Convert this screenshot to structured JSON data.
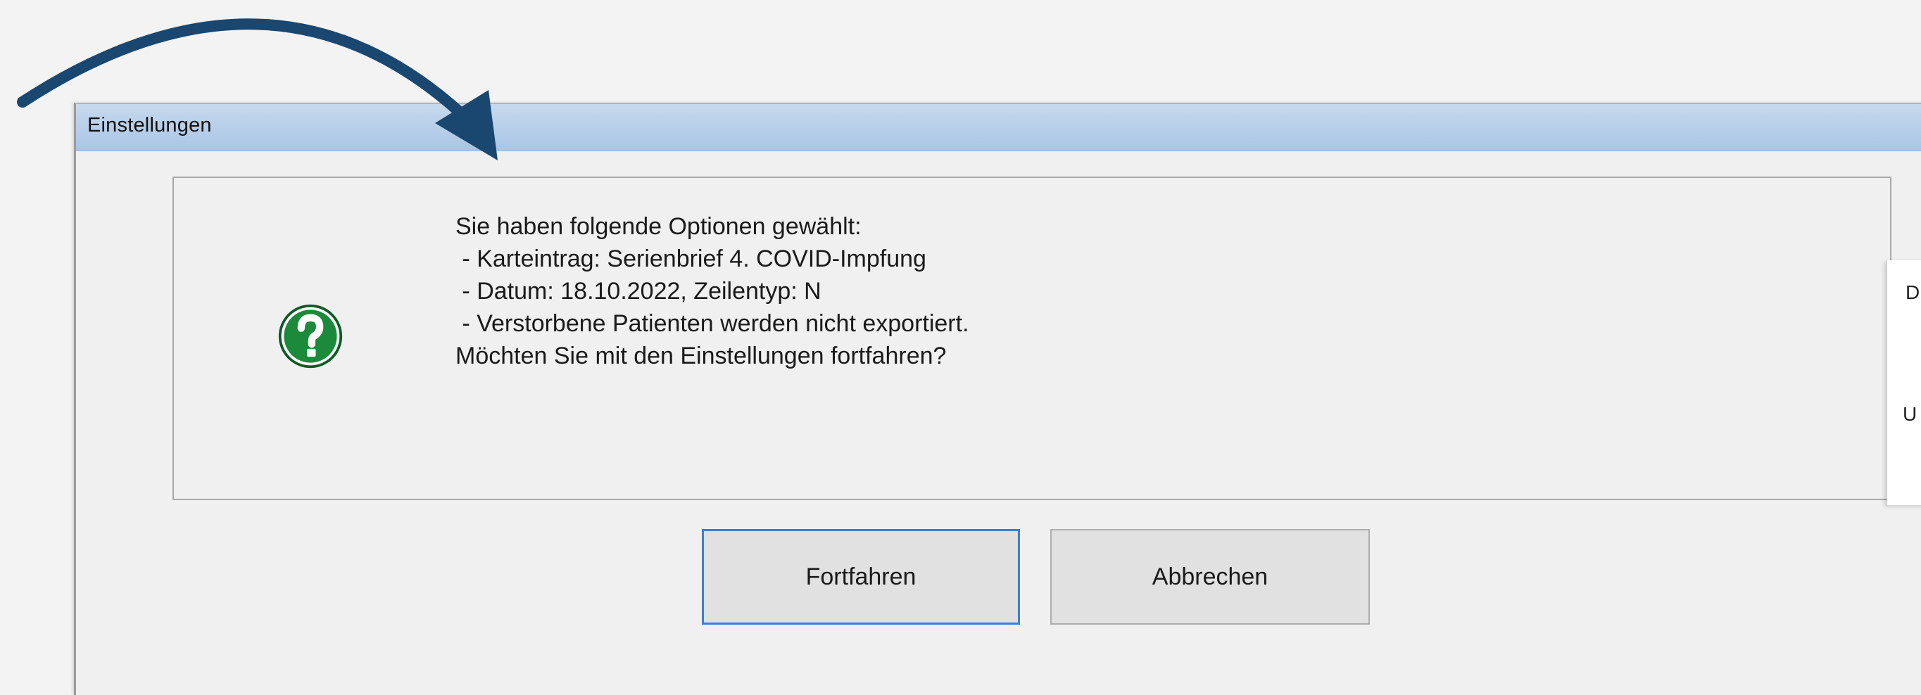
{
  "annotation": {
    "arrow_color": "#1a4770"
  },
  "dialog": {
    "title": "Einstellungen",
    "icon": "question-icon",
    "icon_color": "#1b8a3a",
    "message_lines": [
      "Sie haben folgende Optionen gewählt:",
      " - Karteintrag: Serienbrief 4. COVID-Impfung",
      " - Datum: 18.10.2022, Zeilentyp: N",
      " - Verstorbene Patienten werden nicht exportiert.",
      "Möchten Sie mit den Einstellungen fortfahren?"
    ],
    "buttons": {
      "continue_label": "Fortfahren",
      "cancel_label": "Abbrechen"
    }
  },
  "background_window": {
    "label_top": "D",
    "label_bottom": "U"
  }
}
